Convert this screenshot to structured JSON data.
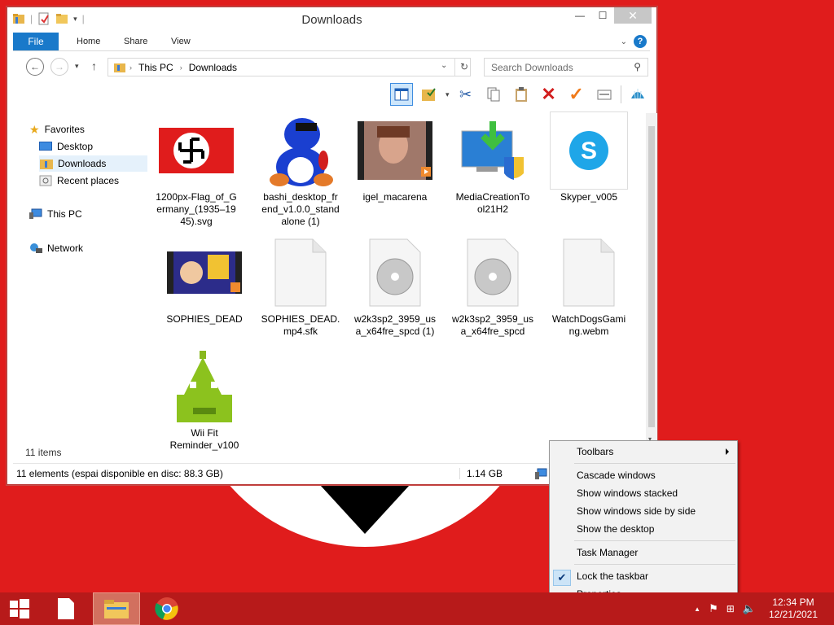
{
  "window": {
    "title": "Downloads",
    "ribbon_tabs": [
      "File",
      "Home",
      "Share",
      "View"
    ],
    "help": "?",
    "collapse": "⌃"
  },
  "address": {
    "crumbs": [
      "This PC",
      "Downloads"
    ],
    "search_placeholder": "Search Downloads"
  },
  "nav_pane": {
    "favorites": "Favorites",
    "desktop": "Desktop",
    "downloads": "Downloads",
    "recent": "Recent places",
    "this_pc": "This PC",
    "network": "Network"
  },
  "files": [
    {
      "name": "1200px-Flag_of_Germany_(1935–1945).svg",
      "lines": [
        "1200px-Flag_of_G",
        "ermany_(1935–19",
        "45).svg"
      ]
    },
    {
      "name": "bashi_desktop_friend_v1.0.0_standalone (1)",
      "lines": [
        "bashi_desktop_fr",
        "end_v1.0.0_stand",
        "alone (1)"
      ]
    },
    {
      "name": "igel_macarena",
      "lines": [
        "igel_macarena"
      ]
    },
    {
      "name": "MediaCreationTool21H2",
      "lines": [
        "MediaCreationTo",
        "ol21H2"
      ]
    },
    {
      "name": "Skyper_v005",
      "lines": [
        "Skyper_v005"
      ]
    },
    {
      "name": "SOPHIES_DEAD",
      "lines": [
        "SOPHIES_DEAD"
      ]
    },
    {
      "name": "SOPHIES_DEAD.mp4.sfk",
      "lines": [
        "SOPHIES_DEAD.",
        "mp4.sfk"
      ]
    },
    {
      "name": "w2k3sp2_3959_usa_x64fre_spcd (1)",
      "lines": [
        "w2k3sp2_3959_us",
        "a_x64fre_spcd (1)"
      ]
    },
    {
      "name": "w2k3sp2_3959_usa_x64fre_spcd",
      "lines": [
        "w2k3sp2_3959_us",
        "a_x64fre_spcd"
      ]
    },
    {
      "name": "WatchDogsGaming.webm",
      "lines": [
        "WatchDogsGami",
        "ng.webm"
      ]
    },
    {
      "name": "Wii Fit Reminder_v100",
      "lines": [
        "Wii Fit",
        "Reminder_v100"
      ]
    }
  ],
  "items_count": "11 items",
  "status": {
    "left": "11 elements (espai disponible en disc: 88.3 GB)",
    "size": "1.14 GB"
  },
  "context_menu": {
    "toolbars": "Toolbars",
    "cascade": "Cascade windows",
    "stacked": "Show windows stacked",
    "side_by_side": "Show windows side by side",
    "show_desktop": "Show the desktop",
    "task_manager": "Task Manager",
    "lock_taskbar": "Lock the taskbar",
    "properties": "Properties",
    "lock_checked": true
  },
  "clock": {
    "time": "12:34 PM",
    "date": "12/21/2021"
  },
  "colors": {
    "desktop": "#e01c1c",
    "taskbar": "#b71a1a",
    "file_tab": "#1979ca"
  }
}
